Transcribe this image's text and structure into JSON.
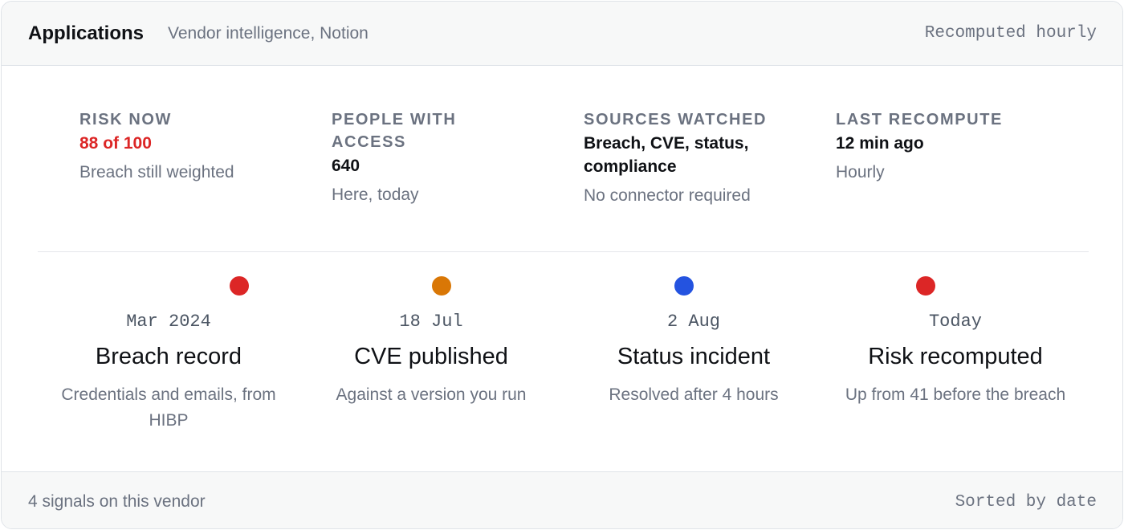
{
  "header": {
    "title": "Applications",
    "subtitle": "Vendor intelligence, Notion",
    "status": "Recomputed hourly"
  },
  "stats": [
    {
      "label": "RISK NOW",
      "value": "88 of 100",
      "value_color": "#dc2626",
      "note": "Breach still weighted"
    },
    {
      "label": "PEOPLE WITH ACCESS",
      "value": "640",
      "note": "Here, today"
    },
    {
      "label": "SOURCES WATCHED",
      "value": "Breach, CVE, status, compliance",
      "note": "No connector required"
    },
    {
      "label": "LAST RECOMPUTE",
      "value": "12 min ago",
      "note": "Hourly"
    }
  ],
  "timeline": [
    {
      "date": "Mar 2024",
      "title": "Breach record",
      "description": "Credentials and emails, from HIBP",
      "dot_color": "#dc2626"
    },
    {
      "date": "18 Jul",
      "title": "CVE published",
      "description": "Against a version you run",
      "dot_color": "#d97706"
    },
    {
      "date": "2 Aug",
      "title": "Status incident",
      "description": "Resolved after 4 hours",
      "dot_color": "#2453e0"
    },
    {
      "date": "Today",
      "title": "Risk recomputed",
      "description": "Up from 41 before the breach",
      "dot_color": "#dc2626"
    }
  ],
  "footer": {
    "summary": "4 signals on this vendor",
    "sort": "Sorted by date"
  }
}
